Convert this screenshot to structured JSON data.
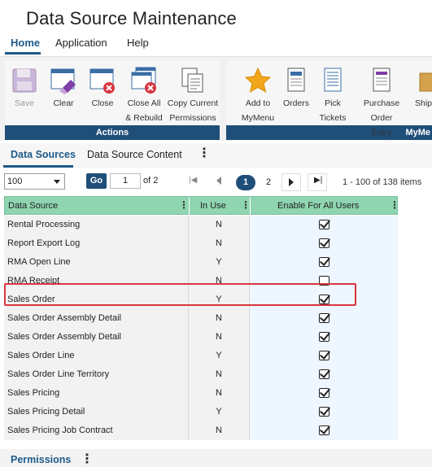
{
  "app": {
    "title": "Data Source Maintenance"
  },
  "menu": {
    "items": [
      "Home",
      "Application",
      "Help"
    ]
  },
  "ribbon": {
    "actions_group": "Actions",
    "mymenu_group": "MyMe",
    "buttons": {
      "save": "Save",
      "clear": "Clear",
      "close": "Close",
      "close_all_1": "Close All",
      "close_all_2": "& Rebuild",
      "copy_perm_1": "Copy Current",
      "copy_perm_2": "Permissions",
      "add_mymenu_1": "Add to",
      "add_mymenu_2": "MyMenu",
      "orders": "Orders",
      "pick_1": "Pick",
      "pick_2": "Tickets",
      "po_1": "Purchase Order",
      "po_2": "Entry",
      "ship": "Ship"
    }
  },
  "tabs": [
    "Data Sources",
    "Data Source Content"
  ],
  "pager": {
    "page_size": "100",
    "go_label": "Go",
    "current_page": "1",
    "of_text": "of 2",
    "pages": [
      "1",
      "2"
    ],
    "items_text": "1 - 100 of 138 items"
  },
  "grid": {
    "columns": [
      "Data Source",
      "In Use",
      "Enable For All Users"
    ],
    "rows": [
      {
        "name": "Rental Processing",
        "in_use": "N",
        "enabled": true
      },
      {
        "name": "Report Export Log",
        "in_use": "N",
        "enabled": true
      },
      {
        "name": "RMA Open Line",
        "in_use": "Y",
        "enabled": true
      },
      {
        "name": "RMA Receipt",
        "in_use": "N",
        "enabled": false
      },
      {
        "name": "Sales Order",
        "in_use": "Y",
        "enabled": true
      },
      {
        "name": "Sales Order Assembly Detail",
        "in_use": "N",
        "enabled": true
      },
      {
        "name": "Sales Order Assembly Detail",
        "in_use": "N",
        "enabled": true
      },
      {
        "name": "Sales Order Line",
        "in_use": "Y",
        "enabled": true
      },
      {
        "name": "Sales Order Line Territory",
        "in_use": "N",
        "enabled": true
      },
      {
        "name": "Sales Pricing",
        "in_use": "N",
        "enabled": true
      },
      {
        "name": "Sales Pricing Detail",
        "in_use": "Y",
        "enabled": true
      },
      {
        "name": "Sales Pricing Job Contract",
        "in_use": "N",
        "enabled": true
      }
    ]
  },
  "bottom": {
    "permissions_label": "Permissions"
  },
  "colors": {
    "accent": "#1f4e79",
    "header_green": "#8fd5b1",
    "highlight": "#d9363e"
  }
}
